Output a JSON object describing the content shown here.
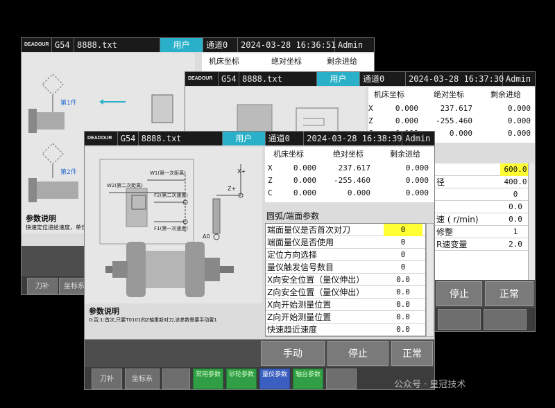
{
  "w1": {
    "logo": "DEADOUR",
    "mode": "G54",
    "file": "8888.txt",
    "user": "用户",
    "channel": "通道0",
    "datetime": "2024-03-28 16:36:51",
    "admin": "Admin",
    "headers": [
      "机床坐标",
      "绝对坐标",
      "剩余进给"
    ],
    "labels": {
      "part1": "第1件",
      "part2": "第2件",
      "desc_title": "参数说明",
      "desc_text": "快速定位进给速度，单位:m"
    },
    "softkeys": [
      "刀补",
      "坐标系"
    ]
  },
  "w2": {
    "logo": "DEADOUR",
    "mode": "G54",
    "file": "8888.txt",
    "user": "用户",
    "channel": "通道0",
    "datetime": "2024-03-28 16:37:30",
    "admin": "Admin",
    "headers": [
      "机床坐标",
      "绝对坐标",
      "剩余进给"
    ],
    "rows": [
      {
        "axis": "X",
        "m": "0.000",
        "a": "237.617",
        "r": "0.000"
      },
      {
        "axis": "Z",
        "m": "0.000",
        "a": "-255.460",
        "r": "0.000"
      },
      {
        "axis": "C",
        "m": "0.000",
        "a": "0.000",
        "r": "0.000"
      }
    ],
    "params": [
      {
        "label": "",
        "value": "600.0"
      },
      {
        "label": "径",
        "value": "400.0"
      },
      {
        "label": "",
        "value": "0"
      },
      {
        "label": "",
        "value": "0.0"
      },
      {
        "label": "速 ( r/min)",
        "value": "0.0"
      },
      {
        "label": "修整",
        "value": "1"
      },
      {
        "label": "R速变量",
        "value": "2.0"
      }
    ],
    "buttons": [
      "停止",
      "正常"
    ]
  },
  "w3": {
    "logo": "DEADOUR",
    "mode": "G54",
    "file": "8888.txt",
    "user": "用户",
    "channel": "通道0",
    "datetime": "2024-03-28 16:38:39",
    "admin": "Admin",
    "headers": [
      "机床坐标",
      "绝对坐标",
      "剩余进给"
    ],
    "rows": [
      {
        "axis": "X",
        "m": "0.000",
        "a": "237.617",
        "r": "0.000"
      },
      {
        "axis": "Z",
        "m": "0.000",
        "a": "-255.460",
        "r": "0.000"
      },
      {
        "axis": "C",
        "m": "0.000",
        "a": "0.000",
        "r": "0.000"
      }
    ],
    "section_title": "圆弧/端面参数",
    "params": [
      {
        "label": "端面量仪是否首次对刀",
        "value": "0"
      },
      {
        "label": "端面量仪是否使用",
        "value": "0"
      },
      {
        "label": "定位方向选择",
        "value": "0"
      },
      {
        "label": "量仪触发信号数目",
        "value": "0"
      },
      {
        "label": "X向安全位置（量仪伸出）",
        "value": "0.0"
      },
      {
        "label": "Z向安全位置（量仪伸出）",
        "value": "0.0"
      },
      {
        "label": "X向开始测量位置",
        "value": "0.0"
      },
      {
        "label": "Z向开始测量位置",
        "value": "0.0"
      },
      {
        "label": "快速趋近速度",
        "value": "0.0"
      }
    ],
    "diagram": {
      "w1": "W1(第一次距离)",
      "w2": "W2(第二次距离)",
      "f2": "F2(第二次速度)",
      "f1": "F1(第一次速度)",
      "x": "X+",
      "z": "Z+",
      "a0": "A0"
    },
    "desc_title": "参数说明",
    "desc_text": "0:否;1:首次,只要T0101的Z轴重新对刀,该参数需要手动置1",
    "buttons": [
      "手动",
      "停止",
      "正常"
    ],
    "softkeys": [
      "刀补",
      "坐标系"
    ],
    "greenkeys": [
      "常用参数",
      "砂轮参数",
      "量仪参数",
      "轴台参数"
    ]
  },
  "watermark": "公众号 · 皇冠技术",
  "colors": {
    "accent": "#2ab0c8",
    "highlight": "#ffff33",
    "green": "#2f9e44"
  }
}
